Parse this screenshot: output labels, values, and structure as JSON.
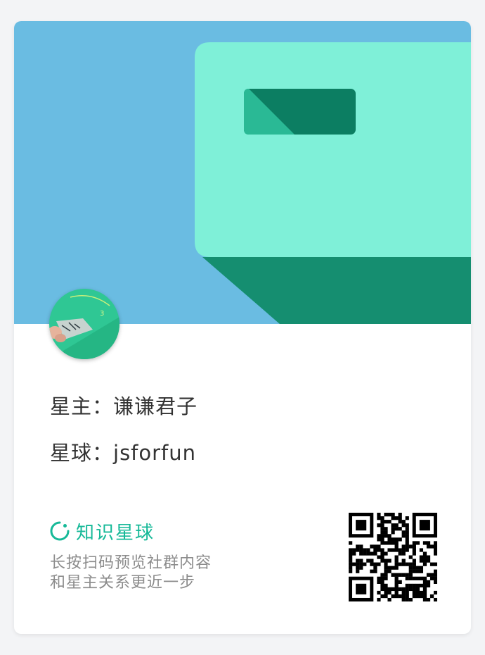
{
  "owner": {
    "label": "星主：",
    "name": "谦谦君子"
  },
  "planet": {
    "label": "星球：",
    "name": "jsforfun"
  },
  "brand": {
    "name": "知识星球",
    "icon": "planet-logo-icon",
    "color": "#16b998"
  },
  "tagline": {
    "line1": "长按扫码预览社群内容",
    "line2": "和星主关系更近一步"
  },
  "colors": {
    "banner_bg": "#6abce2",
    "box_light": "#7ff0d8",
    "box_dark": "#158e70",
    "accent": "#16b998"
  }
}
